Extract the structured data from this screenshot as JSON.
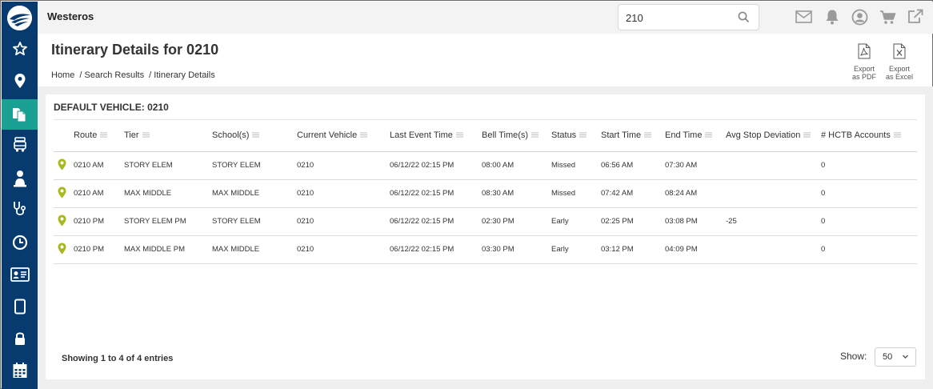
{
  "app": {
    "name": "Westeros"
  },
  "search": {
    "value": "210"
  },
  "page": {
    "title": "Itinerary Details for 0210",
    "breadcrumb": [
      "Home",
      "/ Search Results",
      "/ Itinerary Details"
    ]
  },
  "exports": [
    {
      "line1": "Export",
      "line2": "as PDF",
      "icon": "pdf-file-icon"
    },
    {
      "line1": "Export",
      "line2": "as Excel",
      "icon": "excel-file-icon"
    }
  ],
  "card": {
    "title": "DEFAULT VEHICLE: 0210"
  },
  "table": {
    "columns": [
      "Route",
      "Tier",
      "School(s)",
      "Current Vehicle",
      "Last Event Time",
      "Bell Time(s)",
      "Status",
      "Start Time",
      "End Time",
      "Avg Stop Deviation",
      "# HCTB Accounts"
    ],
    "rows": [
      [
        "0210 AM",
        "STORY ELEM",
        "STORY ELEM",
        "0210",
        "06/12/22 02:15 PM",
        "08:00 AM",
        "Missed",
        "06:56 AM",
        "07:30 AM",
        "",
        "0"
      ],
      [
        "0210 AM",
        "MAX MIDDLE",
        "MAX MIDDLE",
        "0210",
        "06/12/22 02:15 PM",
        "08:30 AM",
        "Missed",
        "07:42 AM",
        "08:24 AM",
        "",
        "0"
      ],
      [
        "0210 PM",
        "STORY ELEM PM",
        "STORY ELEM",
        "0210",
        "06/12/22 02:15 PM",
        "02:30 PM",
        "Early",
        "02:25 PM",
        "03:08 PM",
        "-25",
        "0"
      ],
      [
        "0210 PM",
        "MAX MIDDLE PM",
        "MAX MIDDLE",
        "0210",
        "06/12/22 02:15 PM",
        "03:30 PM",
        "Early",
        "03:12 PM",
        "04:09 PM",
        "",
        "0"
      ]
    ]
  },
  "footer": {
    "entries": "Showing 1 to 4 of 4 entries",
    "show_label": "Show:",
    "page_size": "50"
  },
  "sidebar": {
    "items": [
      "star-icon",
      "map-pin-icon",
      "documents-icon",
      "bus-icon",
      "student-icon",
      "stethoscope-icon",
      "clock-icon",
      "id-card-icon",
      "tablet-icon",
      "lock-icon",
      "calendar-icon"
    ],
    "active_index": 2
  },
  "topbar_icons": [
    "mail-icon",
    "bell-icon",
    "user-circle-icon",
    "cart-icon",
    "external-link-icon"
  ],
  "colors": {
    "sidebar": "#073a6e",
    "sidebar_active": "#1aa193",
    "pin": "#a8b81d",
    "topbar": "#f3f3f3",
    "content_bg": "#efefef"
  }
}
